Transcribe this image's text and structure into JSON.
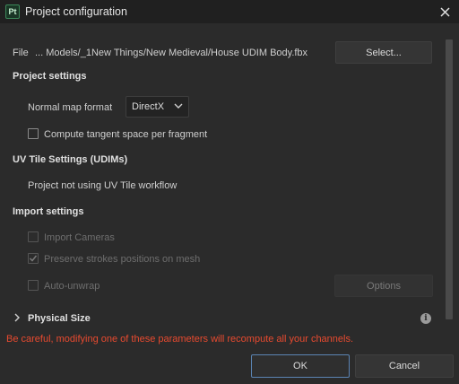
{
  "window": {
    "title": "Project configuration",
    "app_logo_text": "Pt"
  },
  "file": {
    "label": "File",
    "path": "... Models/_1New Things/New Medieval/House UDIM Body.fbx",
    "select_label": "Select..."
  },
  "project_settings": {
    "heading": "Project settings",
    "normal_map_label": "Normal map format",
    "normal_map_value": "DirectX",
    "tangent_label": "Compute tangent space per fragment",
    "tangent_checked": false
  },
  "uv_tile": {
    "heading": "UV Tile Settings (UDIMs)",
    "status": "Project not using UV Tile workflow"
  },
  "import_settings": {
    "heading": "Import settings",
    "import_cameras_label": "Import Cameras",
    "import_cameras_checked": false,
    "preserve_strokes_label": "Preserve strokes positions on mesh",
    "preserve_strokes_checked": true,
    "auto_unwrap_label": "Auto-unwrap",
    "auto_unwrap_checked": false,
    "options_label": "Options"
  },
  "physical_size": {
    "heading": "Physical Size"
  },
  "footer": {
    "warning": "Be careful, modifying one of these parameters will recompute all your channels.",
    "ok_label": "OK",
    "cancel_label": "Cancel"
  },
  "colors": {
    "warning": "#e84a2f",
    "focus_border": "#5b84b3",
    "background": "#2b2b2b"
  }
}
